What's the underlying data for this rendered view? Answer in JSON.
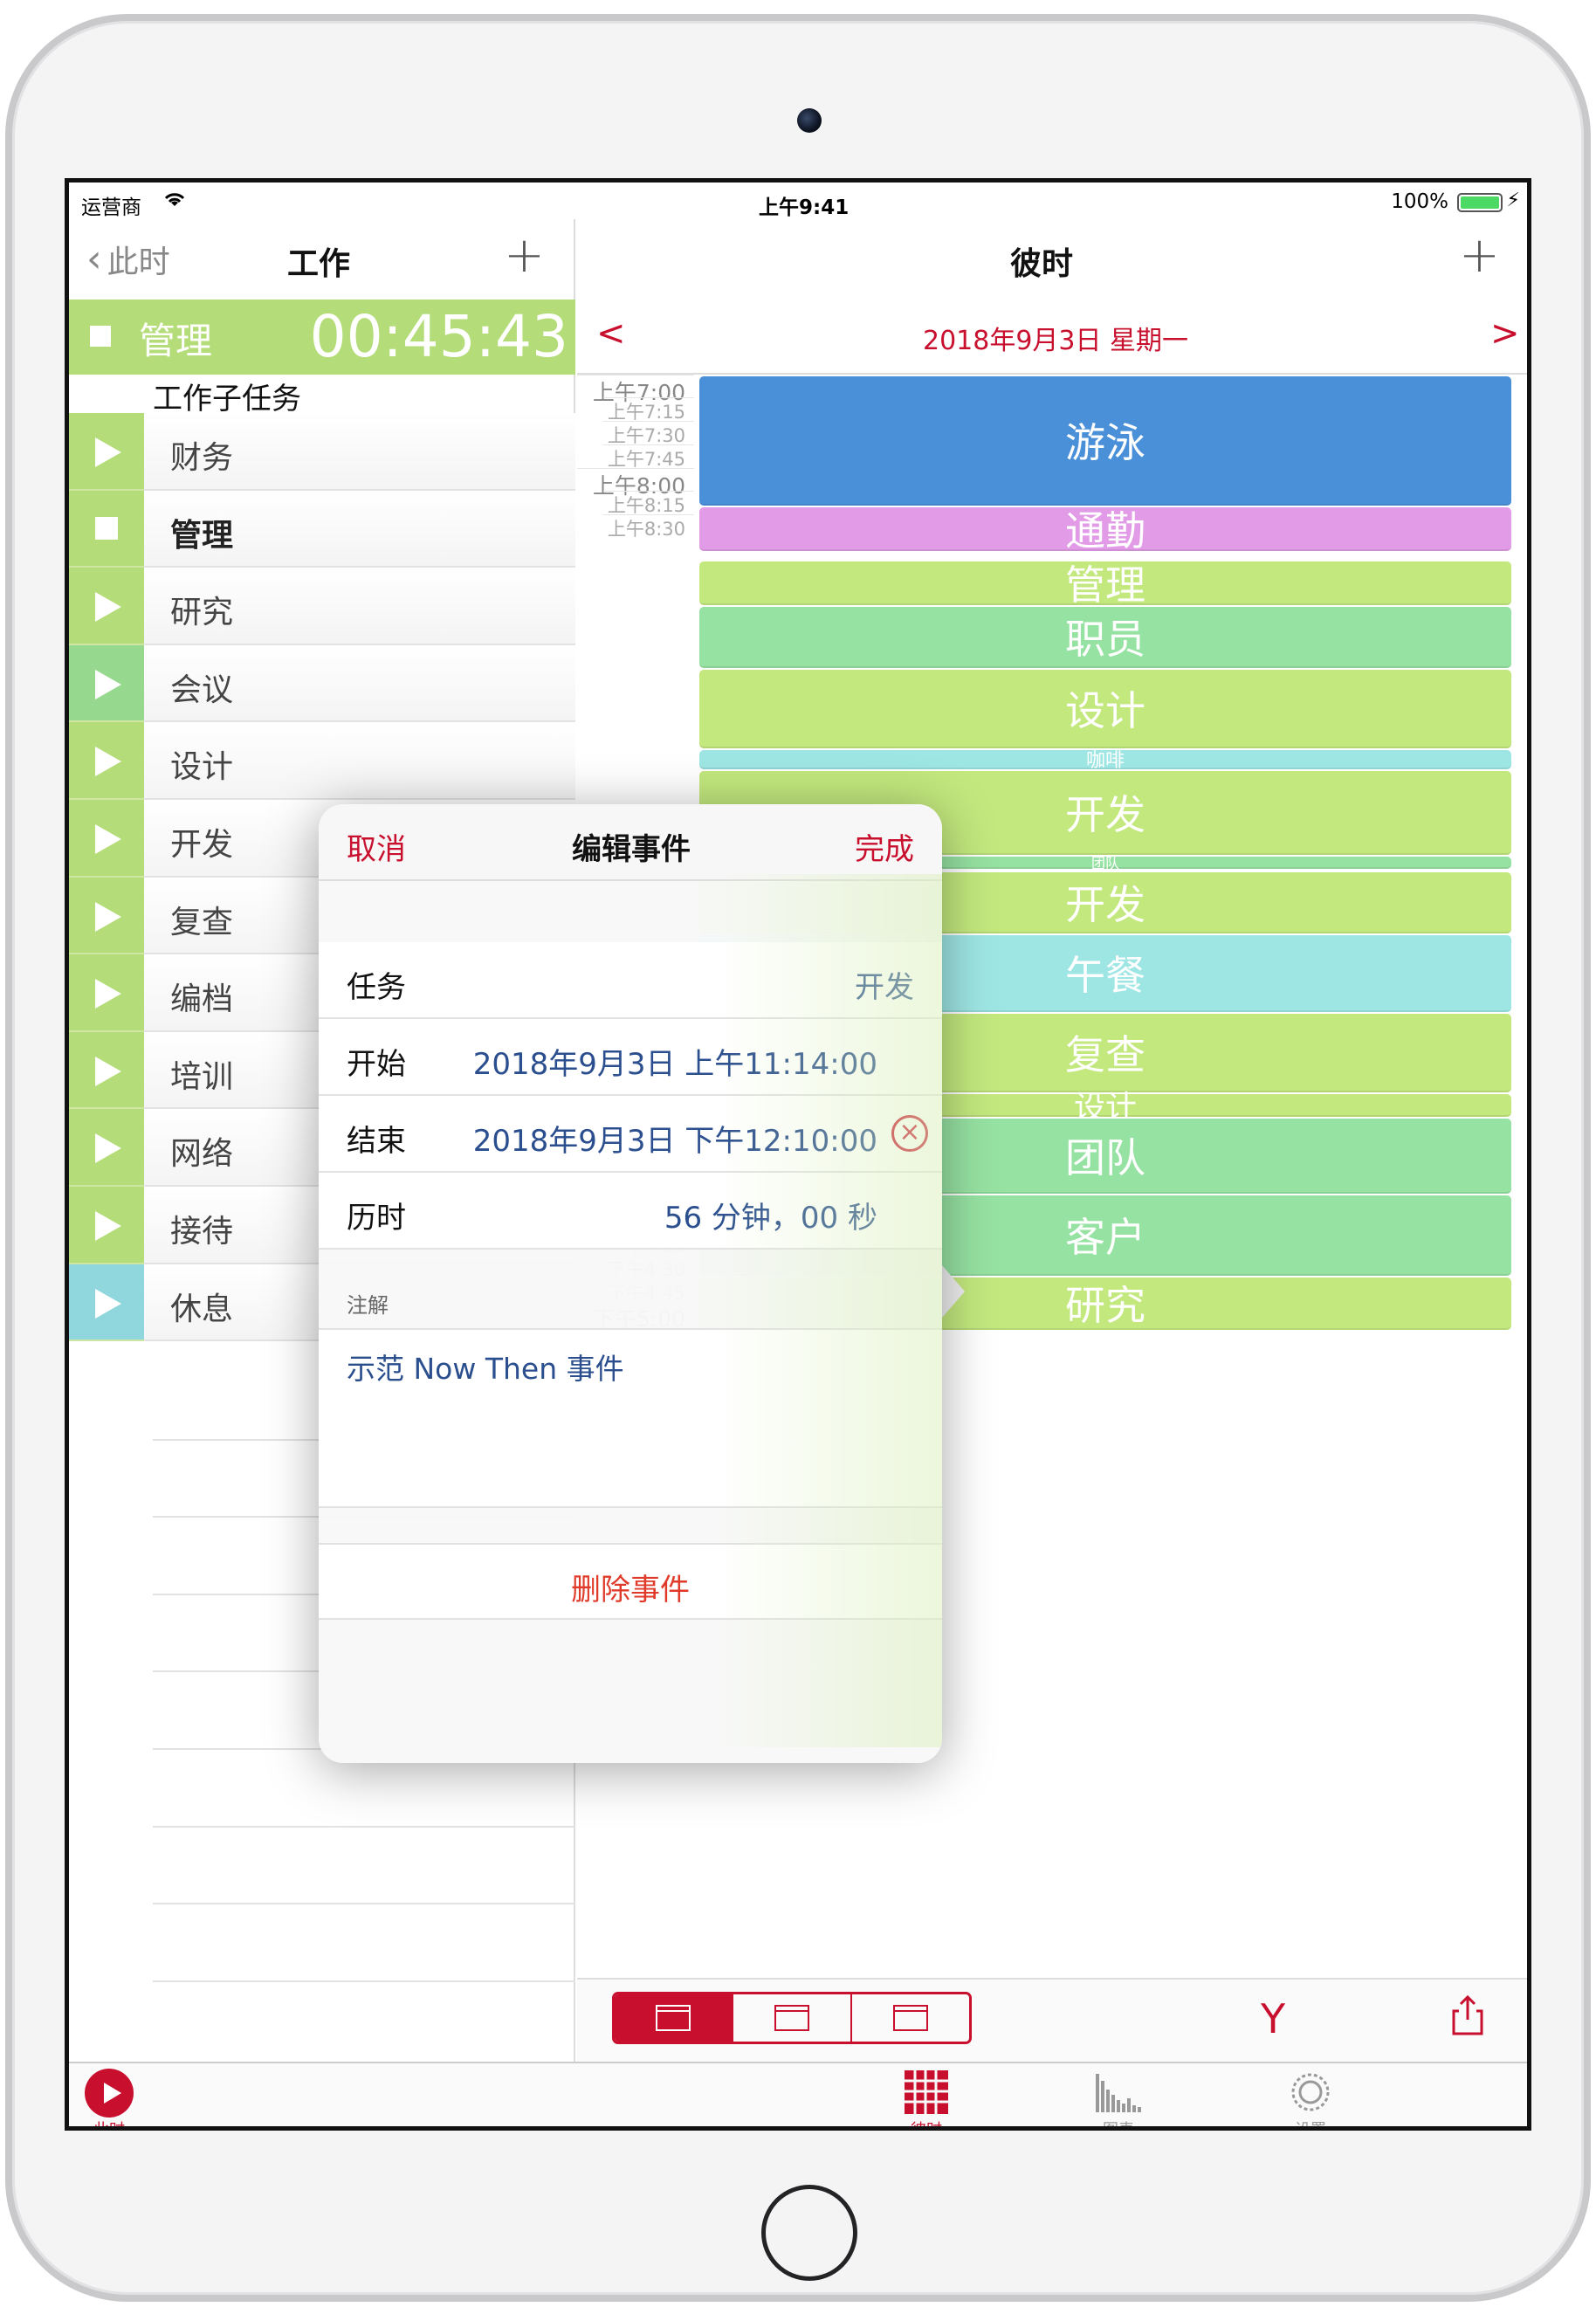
{
  "status_bar": {
    "carrier": "运营商",
    "time": "上午9:41",
    "battery": "100%"
  },
  "left_panel": {
    "back_label": "此时",
    "title": "工作",
    "current_task": {
      "name": "管理",
      "timer": "00:45:43"
    },
    "subtasks_header": "工作子任务",
    "tasks": [
      {
        "label": "财务",
        "state": "play",
        "color": "#b4dc78"
      },
      {
        "label": "管理",
        "state": "stop",
        "color": "#b4dc78"
      },
      {
        "label": "研究",
        "state": "play",
        "color": "#b4dc78"
      },
      {
        "label": "会议",
        "state": "play",
        "color": "#96d88e"
      },
      {
        "label": "设计",
        "state": "play",
        "color": "#b4dc78"
      },
      {
        "label": "开发",
        "state": "play",
        "color": "#b4dc78"
      },
      {
        "label": "复查",
        "state": "play",
        "color": "#b4dc78"
      },
      {
        "label": "编档",
        "state": "play",
        "color": "#b4dc78"
      },
      {
        "label": "培训",
        "state": "play",
        "color": "#b4dc78"
      },
      {
        "label": "网络",
        "state": "play",
        "color": "#b4dc78"
      },
      {
        "label": "接待",
        "state": "play",
        "color": "#b4dc78"
      },
      {
        "label": "休息",
        "state": "play",
        "color": "#8fd7dc"
      }
    ]
  },
  "right_panel": {
    "title": "彼时",
    "date": "2018年9月3日 星期一",
    "prev": "<",
    "next": ">",
    "time_labels": [
      {
        "t": "上午7:00",
        "major": true
      },
      {
        "t": "上午7:15",
        "major": false
      },
      {
        "t": "上午7:30",
        "major": false
      },
      {
        "t": "上午7:45",
        "major": false
      },
      {
        "t": "上午8:00",
        "major": true
      },
      {
        "t": "上午8:15",
        "major": false
      },
      {
        "t": "上午8:30",
        "major": false
      },
      {
        "t": "下午2:45",
        "major": false
      },
      {
        "t": "下午3:00",
        "major": true
      },
      {
        "t": "下午3:15",
        "major": false
      },
      {
        "t": "下午3:30",
        "major": false
      },
      {
        "t": "下午3:45",
        "major": false
      },
      {
        "t": "下午4:00",
        "major": true
      },
      {
        "t": "下午4:15",
        "major": false
      },
      {
        "t": "下午4:30",
        "major": false
      },
      {
        "t": "下午4:45",
        "major": false
      },
      {
        "t": "下午5:00",
        "major": true
      }
    ],
    "events": [
      {
        "label": "游泳",
        "color": "#4a90d9"
      },
      {
        "label": "通勤",
        "color": "#e29be6"
      },
      {
        "label": "管理",
        "color": "#c3e87e"
      },
      {
        "label": "职员",
        "color": "#96e2a2"
      },
      {
        "label": "设计",
        "color": "#c3e87e"
      },
      {
        "label": "咖啡",
        "color": "#9ee6e4"
      },
      {
        "label": "开发",
        "color": "#c3e87e"
      },
      {
        "label": "团队",
        "color": "#96e2a2"
      },
      {
        "label": "开发",
        "color": "#c3e87e"
      },
      {
        "label": "午餐",
        "color": "#9ee6e4"
      },
      {
        "label": "复查",
        "color": "#c3e87e"
      },
      {
        "label": "设计",
        "color": "#c3e87e"
      },
      {
        "label": "团队",
        "color": "#96e2a2"
      },
      {
        "label": "客户",
        "color": "#96e2a2"
      },
      {
        "label": "研究",
        "color": "#c3e87e"
      }
    ]
  },
  "popover": {
    "cancel": "取消",
    "title": "编辑事件",
    "done": "完成",
    "task_label": "任务",
    "task_value": "开发",
    "start_label": "开始",
    "start_value": "2018年9月3日 上午11:14:00",
    "end_label": "结束",
    "end_value": "2018年9月3日 下午12:10:00",
    "duration_label": "历时",
    "duration_value": "56 分钟，00 秒",
    "notes_label": "注解",
    "notes_value": "示范 Now Then 事件",
    "delete_label": "删除事件"
  },
  "tab_bar": {
    "record_label": "此时",
    "tabs": [
      {
        "label": "彼时",
        "icon": "calendar-grid-icon",
        "active": true
      },
      {
        "label": "图表",
        "icon": "bar-chart-icon",
        "active": false
      },
      {
        "label": "设置",
        "icon": "gear-icon",
        "active": false
      }
    ]
  },
  "colors": {
    "accent": "#c8102e",
    "link_blue": "#2b4f8e",
    "task_green": "#b4dc78"
  }
}
